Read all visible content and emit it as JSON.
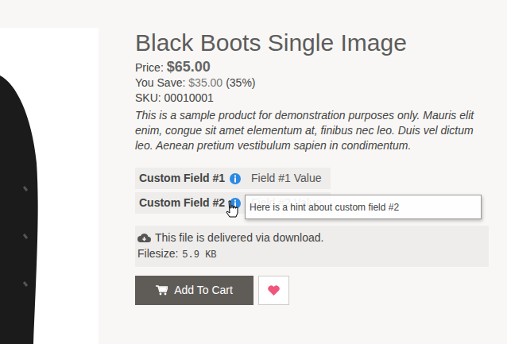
{
  "product": {
    "title": "Black Boots Single Image",
    "price_label": "Price:",
    "price": "$65.00",
    "save_label": "You Save:",
    "save_amount": "$35.00",
    "save_percent": "(35%)",
    "sku": "SKU: 00010001",
    "description": "This is a sample product for demonstration purposes only. Mauris elit enim, congue sit amet elementum at, finibus nec leo. Duis vel dictum leo. Aenean pretium vestibulum sapien in condimentum."
  },
  "custom_fields": [
    {
      "label": "Custom Field #1",
      "value": "Field #1 Value"
    },
    {
      "label": "Custom Field #2",
      "value": "Field #2 Value"
    }
  ],
  "tooltip": {
    "text": "Here is a hint about custom field #2"
  },
  "download": {
    "text": "This file is delivered via download.",
    "filesize_label": "Filesize:",
    "filesize": "5.9 KB"
  },
  "buttons": {
    "add_to_cart": "Add To Cart"
  }
}
